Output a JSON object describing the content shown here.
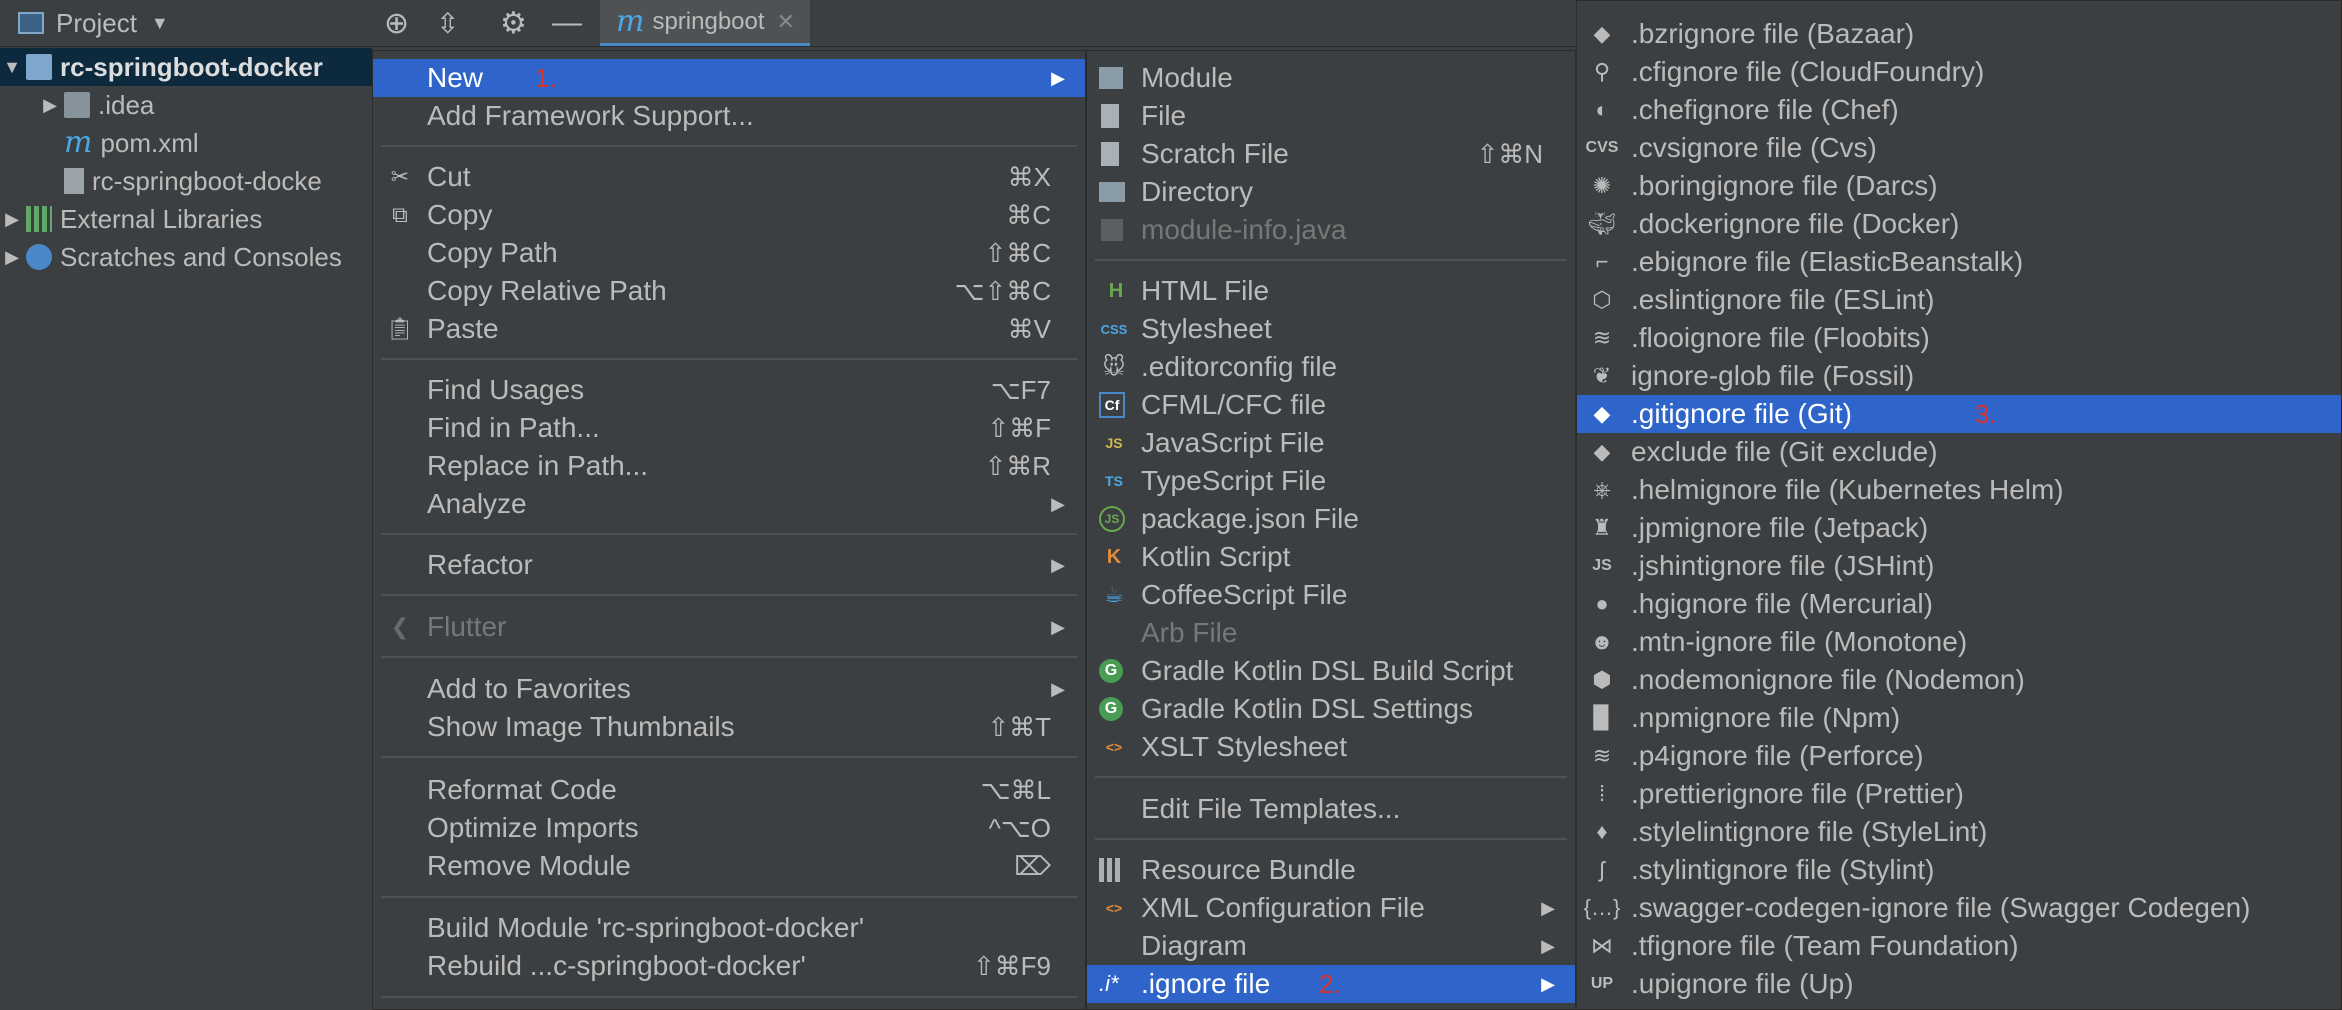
{
  "toolbar": {
    "project_label": "Project",
    "tab_label": "springboot",
    "tab_icon_letter": "m"
  },
  "tree": {
    "root": "rc-springboot-docker",
    "idea": ".idea",
    "pom": "pom.xml",
    "dockerfile": "rc-springboot-docke",
    "external": "External Libraries",
    "scratches": "Scratches and Consoles"
  },
  "context_menu": {
    "new": {
      "label": "New",
      "step": "1."
    },
    "add_framework": "Add Framework Support...",
    "cut": {
      "label": "Cut",
      "shortcut": "⌘X"
    },
    "copy": {
      "label": "Copy",
      "shortcut": "⌘C"
    },
    "copy_path": {
      "label": "Copy Path",
      "shortcut": "⇧⌘C"
    },
    "copy_rel_path": {
      "label": "Copy Relative Path",
      "shortcut": "⌥⇧⌘C"
    },
    "paste": {
      "label": "Paste",
      "shortcut": "⌘V"
    },
    "find_usages": {
      "label": "Find Usages",
      "shortcut": "⌥F7"
    },
    "find_in_path": {
      "label": "Find in Path...",
      "shortcut": "⇧⌘F"
    },
    "replace_in_path": {
      "label": "Replace in Path...",
      "shortcut": "⇧⌘R"
    },
    "analyze": "Analyze",
    "refactor": "Refactor",
    "flutter": "Flutter",
    "add_favorites": "Add to Favorites",
    "show_thumbnails": {
      "label": "Show Image Thumbnails",
      "shortcut": "⇧⌘T"
    },
    "reformat": {
      "label": "Reformat Code",
      "shortcut": "⌥⌘L"
    },
    "optimize": {
      "label": "Optimize Imports",
      "shortcut": "^⌥O"
    },
    "remove_module": {
      "label": "Remove Module",
      "shortcut": "⌦"
    },
    "build_module": "Build Module 'rc-springboot-docker'",
    "rebuild": {
      "label": "Rebuild ...c-springboot-docker'",
      "shortcut": "⇧⌘F9"
    }
  },
  "new_menu": {
    "module": "Module",
    "file": "File",
    "scratch": {
      "label": "Scratch File",
      "shortcut": "⇧⌘N"
    },
    "directory": "Directory",
    "module_info": "module-info.java",
    "html": "HTML File",
    "stylesheet": "Stylesheet",
    "editorconfig": ".editorconfig file",
    "cfml": "CFML/CFC file",
    "javascript": "JavaScript File",
    "typescript": "TypeScript File",
    "package_json": "package.json File",
    "kotlin": "Kotlin Script",
    "coffee": "CoffeeScript File",
    "arb": "Arb File",
    "gradle_build": "Gradle Kotlin DSL Build Script",
    "gradle_settings": "Gradle Kotlin DSL Settings",
    "xslt": "XSLT Stylesheet",
    "edit_templates": "Edit File Templates...",
    "resource_bundle": "Resource Bundle",
    "xml_config": "XML Configuration File",
    "diagram": "Diagram",
    "ignore": {
      "label": ".ignore file",
      "step": "2.",
      "icon_text": ".i*"
    }
  },
  "ignore_menu": {
    "items": [
      {
        "label": ".bzrignore file (Bazaar)",
        "icon": "bazaar-icon"
      },
      {
        "label": ".cfignore file (CloudFoundry)",
        "icon": "cloudfoundry-icon"
      },
      {
        "label": ".chefignore file (Chef)",
        "icon": "chef-icon"
      },
      {
        "label": ".cvsignore file (Cvs)",
        "icon": "cvs-icon",
        "icon_text": "CVS"
      },
      {
        "label": ".boringignore file (Darcs)",
        "icon": "darcs-icon"
      },
      {
        "label": ".dockerignore file (Docker)",
        "icon": "docker-icon"
      },
      {
        "label": ".ebignore file (ElasticBeanstalk)",
        "icon": "elasticbeanstalk-icon"
      },
      {
        "label": ".eslintignore file (ESLint)",
        "icon": "eslint-icon"
      },
      {
        "label": ".flooignore file (Floobits)",
        "icon": "floobits-icon"
      },
      {
        "label": "ignore-glob file (Fossil)",
        "icon": "fossil-icon"
      },
      {
        "label": ".gitignore file (Git)",
        "icon": "git-icon",
        "step": "3."
      },
      {
        "label": "exclude file (Git exclude)",
        "icon": "git-exclude-icon"
      },
      {
        "label": ".helmignore file (Kubernetes Helm)",
        "icon": "helm-icon"
      },
      {
        "label": ".jpmignore file (Jetpack)",
        "icon": "jetpack-icon"
      },
      {
        "label": ".jshintignore file (JSHint)",
        "icon": "jshint-icon",
        "icon_text": "JS"
      },
      {
        "label": ".hgignore file (Mercurial)",
        "icon": "mercurial-icon"
      },
      {
        "label": ".mtn-ignore file (Monotone)",
        "icon": "monotone-icon"
      },
      {
        "label": ".nodemonignore file (Nodemon)",
        "icon": "nodemon-icon"
      },
      {
        "label": ".npmignore file (Npm)",
        "icon": "npm-icon"
      },
      {
        "label": ".p4ignore file (Perforce)",
        "icon": "perforce-icon"
      },
      {
        "label": ".prettierignore file (Prettier)",
        "icon": "prettier-icon"
      },
      {
        "label": ".stylelintignore file (StyleLint)",
        "icon": "stylelint-icon"
      },
      {
        "label": ".stylintignore file (Stylint)",
        "icon": "stylint-icon"
      },
      {
        "label": ".swagger-codegen-ignore file (Swagger Codegen)",
        "icon": "swagger-icon"
      },
      {
        "label": ".tfignore file (Team Foundation)",
        "icon": "teamfoundation-icon"
      },
      {
        "label": ".upignore file (Up)",
        "icon": "up-icon",
        "icon_text": "UP"
      }
    ]
  }
}
